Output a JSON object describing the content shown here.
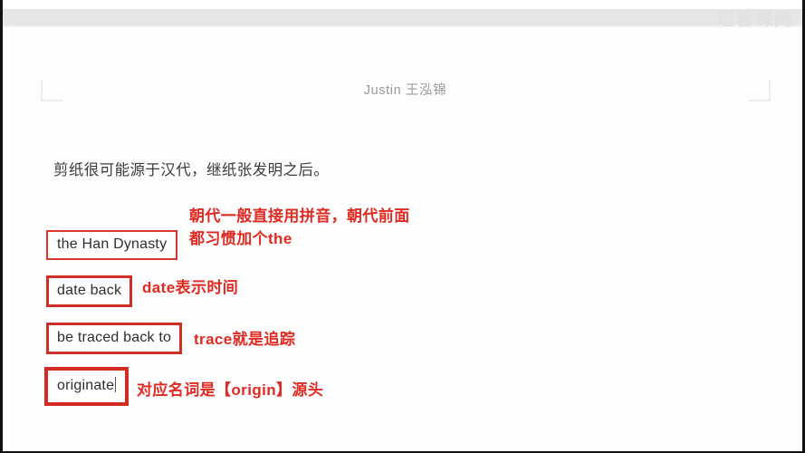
{
  "window": {
    "watermark_text": "逗香课网"
  },
  "document": {
    "header_text": "Justin 王泓锦",
    "paragraph": "剪纸很可能源于汉代，继纸张发明之后。"
  },
  "annotations": [
    {
      "id": "han",
      "term": "the Han Dynasty",
      "note_lines": [
        "朝代一般直接用拼音，朝代前面",
        "都习惯加个the"
      ],
      "box_style": "thin",
      "has_caret": false
    },
    {
      "id": "date",
      "term": "date back",
      "note_lines": [
        "date表示时间"
      ],
      "box_style": "medium",
      "has_caret": false
    },
    {
      "id": "traced",
      "term": "be traced back to",
      "note_lines": [
        "trace就是追踪"
      ],
      "box_style": "medium",
      "has_caret": false
    },
    {
      "id": "originate",
      "term": "originate",
      "note_lines": [
        "对应名词是【origin】源头"
      ],
      "box_style": "thick",
      "has_caret": true
    }
  ],
  "colors": {
    "annotation_red": "#e02a22",
    "box_border_red": "#d22b22",
    "body_text": "#3b3b3b",
    "header_text": "#9a9a9a",
    "page_background": "#fdfdfd",
    "chrome_band": "#e6e6e6"
  }
}
